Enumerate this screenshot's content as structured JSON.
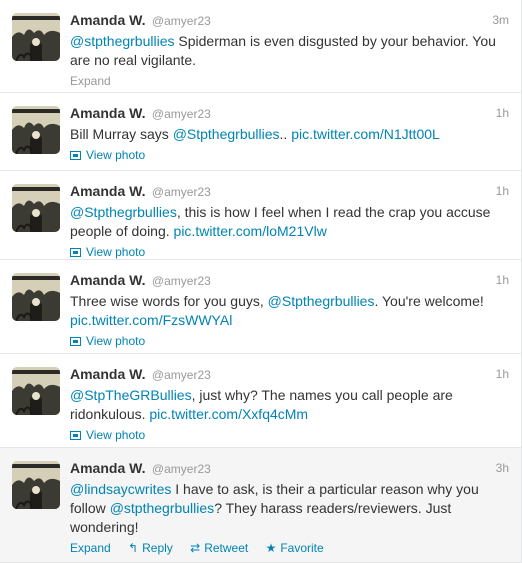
{
  "tweets": [
    {
      "name": "Amanda W.",
      "handle": "@amyer23",
      "time": "3m",
      "mention": "@stpthegrbullies",
      "text_a": " Spiderman is even disgusted by your behavior. You are no real vigilante.",
      "action": "Expand"
    },
    {
      "name": "Amanda W.",
      "handle": "@amyer23",
      "time": "1h",
      "text_pre": "Bill Murray says ",
      "mention": "@Stpthegrbullies",
      "text_mid": ".. ",
      "pic": "pic.twitter.com/N1Jtt00L",
      "view_photo": "View photo"
    },
    {
      "name": "Amanda W.",
      "handle": "@amyer23",
      "time": "1h",
      "mention": "@Stpthegrbullies",
      "text_mid": ", this is how I feel when I read the crap you accuse people of doing. ",
      "pic": "pic.twitter.com/loM21Vlw",
      "view_photo": "View photo"
    },
    {
      "name": "Amanda W.",
      "handle": "@amyer23",
      "time": "1h",
      "text_pre": "Three wise words for you guys, ",
      "mention": "@Stpthegrbullies",
      "text_mid": ". You're welcome! ",
      "pic": "pic.twitter.com/FzsWWYAl",
      "view_photo": "View photo"
    },
    {
      "name": "Amanda W.",
      "handle": "@amyer23",
      "time": "1h",
      "mention": "@StpTheGRBullies",
      "text_mid": ", just why? The names you call people are ridonkulous. ",
      "pic": "pic.twitter.com/Xxfq4cMm",
      "view_photo": "View photo"
    },
    {
      "name": "Amanda W.",
      "handle": "@amyer23",
      "time": "3h",
      "mention1": "@lindsaycwrites",
      "text_a": " I have to ask, is their a particular reason why you follow ",
      "mention2": "@stpthegrbullies",
      "text_b": "? They harass readers/reviewers. Just wondering!",
      "actions": {
        "expand": "Expand",
        "reply": "Reply",
        "retweet": "Retweet",
        "favorite": "Favorite"
      }
    }
  ],
  "icons": {
    "reply": "reply-arrow-icon",
    "retweet": "retweet-icon",
    "favorite": "star-icon",
    "photo": "photo-icon"
  },
  "colors": {
    "link": "#0084b4",
    "meta": "#999999",
    "text": "#333333",
    "highlight_bg": "#f5f5f5"
  }
}
